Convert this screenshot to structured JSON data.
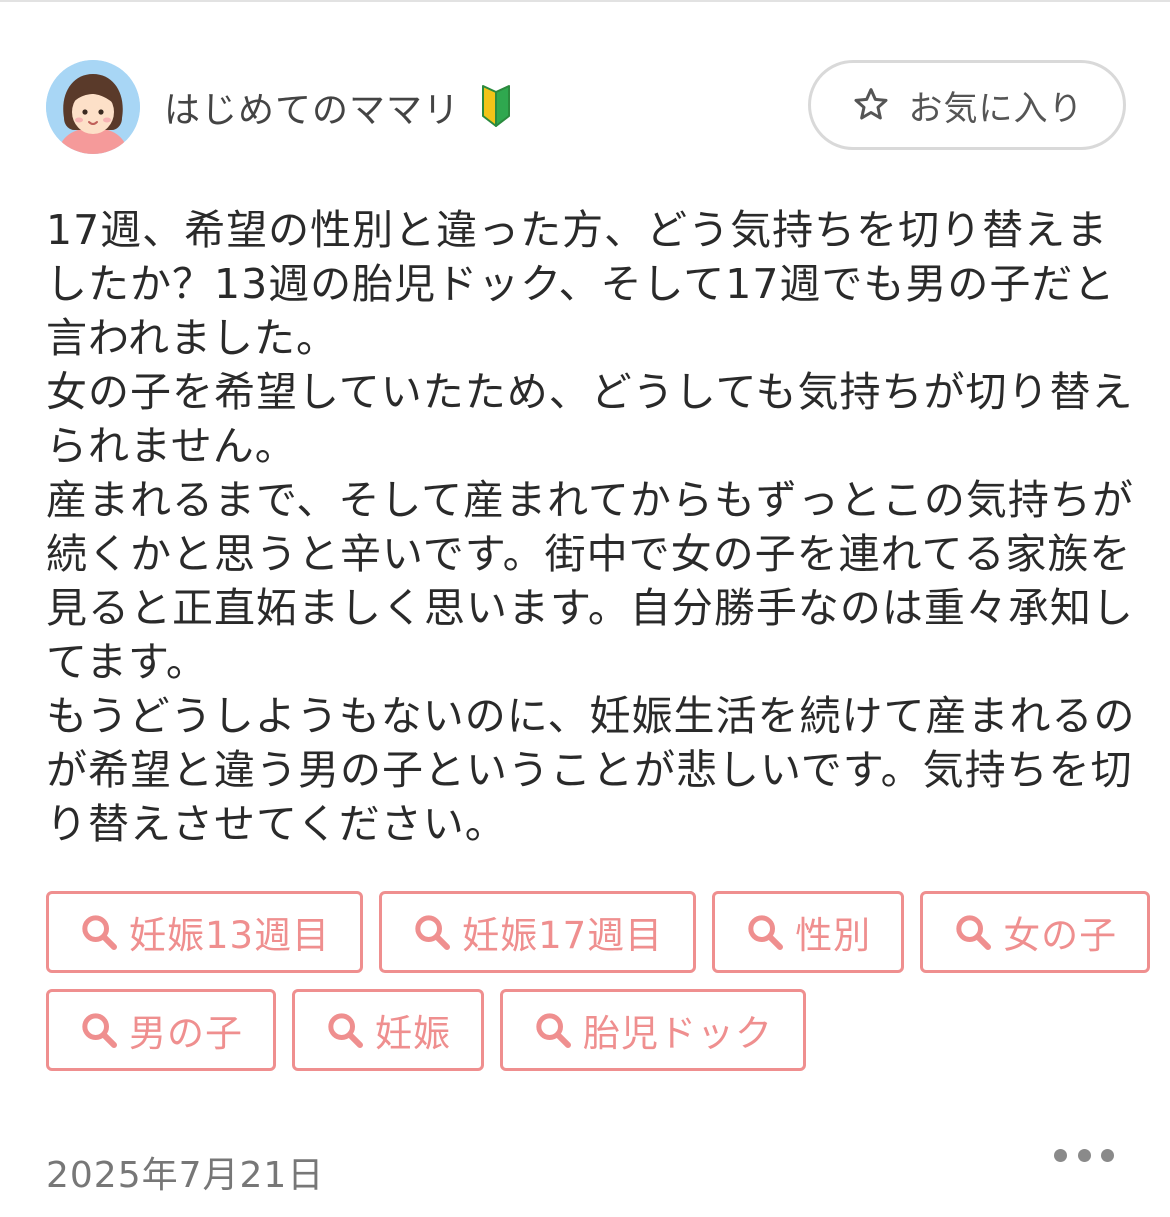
{
  "author": {
    "name": "はじめてのママリ",
    "beginner_badge": "beginner-mark-icon"
  },
  "favorite_button": {
    "label": "お気に入り",
    "icon": "star-outline-icon"
  },
  "post": {
    "paragraphs": [
      "17週、希望の性別と違った方、どう気持ちを切り替えましたか？13週の胎児ドック、そして17週でも男の子だと言われました。",
      "女の子を希望していたため、どうしても気持ちが切り替えられません。",
      "産まれるまで、そして産まれてからもずっとこの気持ちが続くかと思うと辛いです。街中で女の子を連れてる家族を見ると正直妬ましく思います。自分勝手なのは重々承知してます。",
      "もうどうしようもないのに、妊娠生活を続けて産まれるのが希望と違う男の子ということが悲しいです。気持ちを切り替えさせてください。"
    ]
  },
  "tags": [
    {
      "label": "妊娠13週目"
    },
    {
      "label": "妊娠17週目"
    },
    {
      "label": "性別"
    },
    {
      "label": "女の子"
    },
    {
      "label": "男の子"
    },
    {
      "label": "妊娠"
    },
    {
      "label": "胎児ドック"
    }
  ],
  "footer": {
    "date": "2025年7月21日",
    "more_icon": "more-dots-icon"
  },
  "colors": {
    "tag_accent": "#ef8f8f",
    "avatar_bg": "#a8d6f5"
  }
}
